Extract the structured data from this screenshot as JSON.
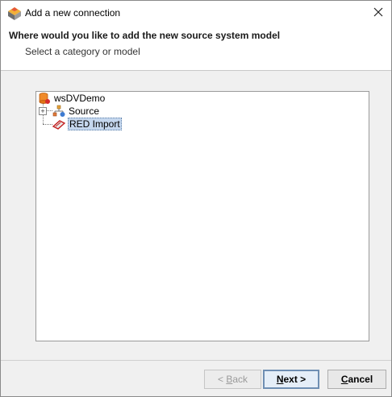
{
  "window": {
    "title": "Add a new connection"
  },
  "header": {
    "title": "Where would you like to add the new source system model",
    "subtitle": "Select a category or model"
  },
  "tree": {
    "root": {
      "label": "wsDVDemo",
      "icon": "database-icon"
    },
    "items": [
      {
        "label": "Source",
        "icon": "network-model-icon",
        "expander": "+"
      },
      {
        "label": "RED Import",
        "icon": "red-import-icon",
        "selected": true
      }
    ]
  },
  "buttons": {
    "back": {
      "prefix": "< ",
      "mnemonic": "B",
      "rest": "ack"
    },
    "next": {
      "mnemonic": "N",
      "rest": "ext >"
    },
    "cancel": {
      "mnemonic": "C",
      "rest": "ancel"
    }
  },
  "colors": {
    "selection": "#c5d7ee",
    "default_button_border": "#6f8fb3"
  }
}
